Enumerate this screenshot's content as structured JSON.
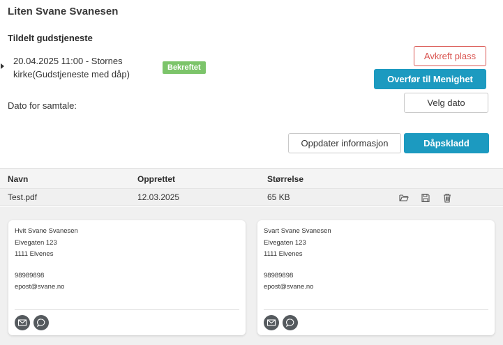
{
  "header": {
    "title": "Liten Svane Svanesen"
  },
  "service": {
    "section_title": "Tildelt gudstjeneste",
    "description": "20.04.2025 11:00 - Stornes kirke(Gudstjeneste med dåp)",
    "badge": "Bekreftet",
    "cancel_label": "Avkreft plass",
    "transfer_label": "Overfør til Menighet"
  },
  "conversation": {
    "label": "Dato for samtale:",
    "choose_date_label": "Velg dato"
  },
  "actions": {
    "update_label": "Oppdater informasjon",
    "draft_label": "Dåpskladd"
  },
  "files": {
    "columns": [
      "Navn",
      "Opprettet",
      "Størrelse"
    ],
    "rows": [
      {
        "name": "Test.pdf",
        "created": "12.03.2025",
        "size": "65 KB"
      }
    ],
    "row_icons": [
      "folder-open-icon",
      "save-icon",
      "trash-icon"
    ]
  },
  "contacts": [
    {
      "name": "Hvit Svane Svanesen",
      "street": "Elvegaten 123",
      "postal": "1111 Elvenes",
      "phone": "98989898",
      "email": "epost@svane.no"
    },
    {
      "name": "Svart Svane Svanesen",
      "street": "Elvegaten 123",
      "postal": "1111 Elvenes",
      "phone": "98989898",
      "email": "epost@svane.no"
    }
  ],
  "colors": {
    "primary": "#1c9ac0",
    "danger": "#d9534f",
    "success_badge": "#7cc46a",
    "icon_circle": "#555a5e"
  }
}
